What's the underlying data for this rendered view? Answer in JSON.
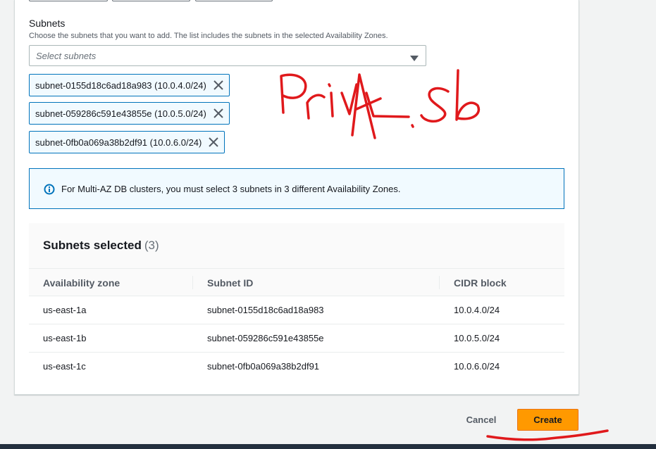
{
  "subnets_field": {
    "label": "Subnets",
    "description": "Choose the subnets that you want to add. The list includes the subnets in the selected Availability Zones.",
    "placeholder": "Select subnets"
  },
  "tokens": [
    {
      "label": "subnet-0155d18c6ad18a983 (10.0.4.0/24)"
    },
    {
      "label": "subnet-059286c591e43855e (10.0.5.0/24)"
    },
    {
      "label": "subnet-0fb0a069a38b2df91 (10.0.6.0/24)"
    }
  ],
  "alert": {
    "message": "For Multi-AZ DB clusters, you must select 3 subnets in 3 different Availability Zones."
  },
  "selected": {
    "title": "Subnets selected",
    "count": "(3)",
    "columns": [
      "Availability zone",
      "Subnet ID",
      "CIDR block"
    ],
    "rows": [
      {
        "az": "us-east-1a",
        "subnet_id": "subnet-0155d18c6ad18a983",
        "cidr": "10.0.4.0/24"
      },
      {
        "az": "us-east-1b",
        "subnet_id": "subnet-059286c591e43855e",
        "cidr": "10.0.5.0/24"
      },
      {
        "az": "us-east-1c",
        "subnet_id": "subnet-0fb0a069a38b2df91",
        "cidr": "10.0.6.0/24"
      }
    ]
  },
  "actions": {
    "cancel_label": "Cancel",
    "create_label": "Create"
  },
  "annotation": {
    "handwritten_text": "PrivAt.sb",
    "color": "#e0191c"
  },
  "colors": {
    "primary_button": "#ff9900",
    "info_blue": "#0073bb",
    "footer": "#232f3e"
  },
  "icons": {
    "select_caret": "caret-down-icon",
    "token_remove": "close-icon",
    "alert": "info-icon"
  }
}
